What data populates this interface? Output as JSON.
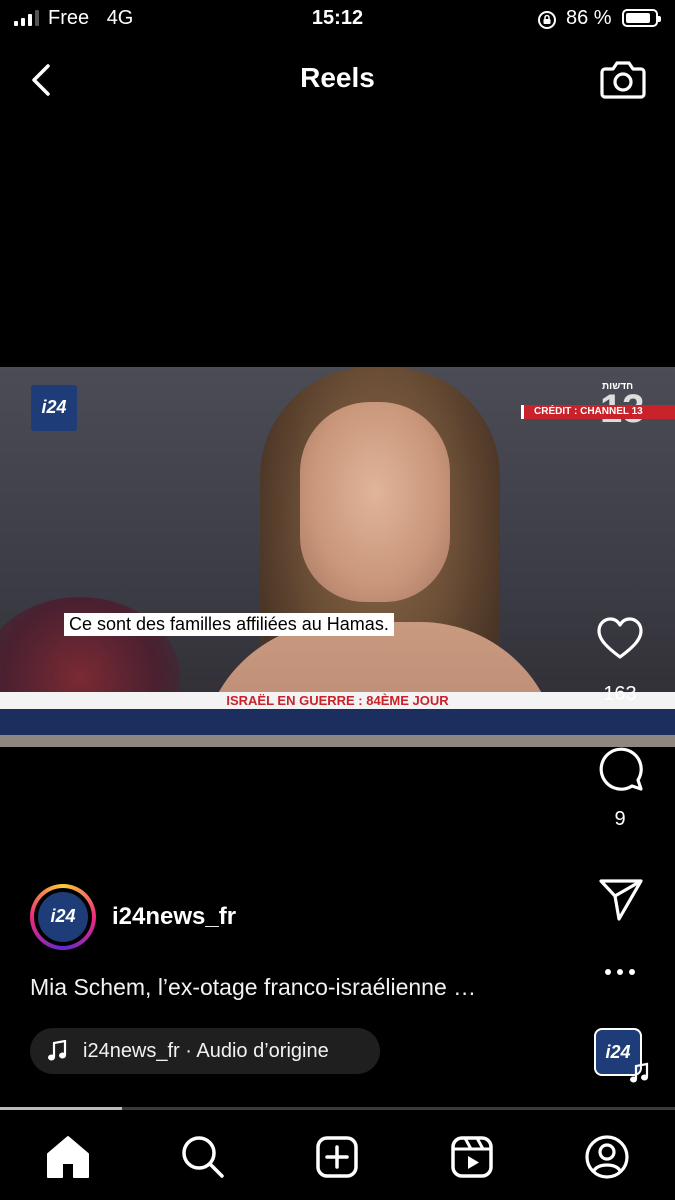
{
  "status_bar": {
    "carrier": "Free",
    "network": "4G",
    "time": "15:12",
    "battery": "86 %",
    "battery_level": 0.86
  },
  "header": {
    "title": "Reels",
    "back_icon": "chevron-left-icon",
    "camera_icon": "camera-icon"
  },
  "video": {
    "logo_text": "i24",
    "credit": "CRÉDIT : CHANNEL 13",
    "channel_number": "13",
    "channel_hebrew": "חדשות",
    "subtitle": "Ce sont des familles affiliées au Hamas.",
    "ticker": "ISRAËL EN GUERRE : 84ÈME JOUR"
  },
  "actions": {
    "likes": "163",
    "comments": "9",
    "like_icon": "heart-icon",
    "comment_icon": "comment-icon",
    "share_icon": "send-icon",
    "more_icon": "more-icon"
  },
  "post": {
    "avatar_text": "i24",
    "username": "i24news_fr",
    "caption": "Mia Schem, l’ex-otage franco-israélienne …",
    "audio": "i24news_fr · Audio d’origine",
    "audio_thumb_text": "i24",
    "progress": 0.18
  },
  "tabbar": {
    "items": [
      "home-icon",
      "search-icon",
      "create-icon",
      "reels-icon",
      "profile-icon"
    ]
  }
}
